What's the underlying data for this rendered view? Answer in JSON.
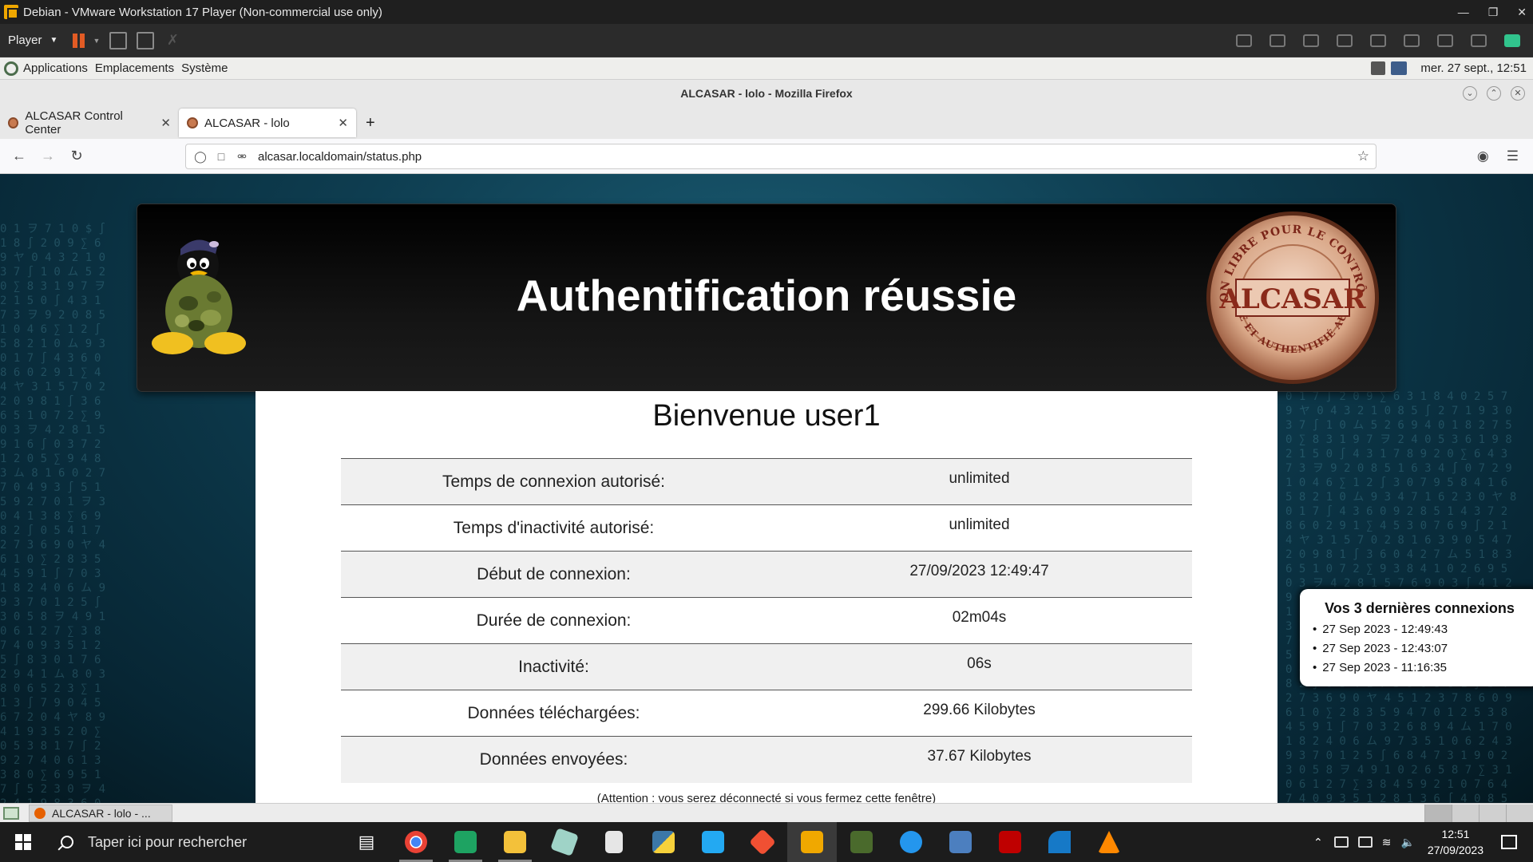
{
  "vmware": {
    "title": "Debian - VMware Workstation 17 Player (Non-commercial use only)",
    "player_menu": "Player"
  },
  "gnome_panel": {
    "menus": [
      "Applications",
      "Emplacements",
      "Système"
    ],
    "clock": "mer. 27 sept., 12:51"
  },
  "firefox": {
    "window_title": "ALCASAR - lolo - Mozilla Firefox",
    "tabs": [
      {
        "label": "ALCASAR Control Center",
        "active": false
      },
      {
        "label": "ALCASAR - lolo",
        "active": true
      }
    ],
    "url": "alcasar.localdomain/status.php"
  },
  "page": {
    "banner_title": "Authentification réussie",
    "seal_top_text": "APPLICATION LIBRE POUR LE CONTRÔLE D'ACCÈS",
    "seal_bottom_text": "SÉCURISÉ ET AUTHENTIFIÉ AU RÉSEAU",
    "seal_brand": "ALCASAR",
    "welcome": "Bienvenue user1",
    "rows": [
      {
        "label": "Temps de connexion autorisé:",
        "value": "unlimited"
      },
      {
        "label": "Temps d'inactivité autorisé:",
        "value": "unlimited"
      },
      {
        "label": "Début de connexion:",
        "value": "27/09/2023 12:49:47"
      },
      {
        "label": "Durée de connexion:",
        "value": "02m04s"
      },
      {
        "label": "Inactivité:",
        "value": "06s"
      },
      {
        "label": "Données téléchargées:",
        "value": "299.66 Kilobytes"
      },
      {
        "label": "Données envoyées:",
        "value": "37.67 Kilobytes"
      }
    ],
    "notice": "(Attention : vous serez déconnecté si vous fermez cette fenêtre)"
  },
  "last_connections": {
    "title": "Vos 3 dernières connexions",
    "items": [
      "27 Sep 2023 - 12:49:43",
      "27 Sep 2023 - 12:43:07",
      "27 Sep 2023 - 11:16:35"
    ]
  },
  "gnome_bottom": {
    "task_label": "ALCASAR - lolo - ..."
  },
  "taskbar": {
    "search_placeholder": "Taper ici pour rechercher",
    "time": "12:51",
    "date": "27/09/2023",
    "apps": [
      {
        "name": "task-view-icon"
      },
      {
        "name": "chrome-icon",
        "color": "#e94235"
      },
      {
        "name": "google-chat-icon",
        "color": "#1ea362"
      },
      {
        "name": "file-explorer-icon",
        "color": "#f3c13a"
      },
      {
        "name": "notepadpp-icon",
        "color": "#9fd3c7"
      },
      {
        "name": "document-icon",
        "color": "#e6e6e6"
      },
      {
        "name": "python-icon",
        "color": "#3b77a8"
      },
      {
        "name": "vscode-icon",
        "color": "#23a9f2"
      },
      {
        "name": "git-icon",
        "color": "#f05033"
      },
      {
        "name": "vmware-icon",
        "color": "#f0a800"
      },
      {
        "name": "pgadmin-icon",
        "color": "#4a6a2c"
      },
      {
        "name": "docker-icon",
        "color": "#2496ed"
      },
      {
        "name": "network-icon",
        "color": "#4c7fbf"
      },
      {
        "name": "filezilla-icon",
        "color": "#bf0000"
      },
      {
        "name": "wireshark-icon",
        "color": "#1679c7"
      },
      {
        "name": "vlc-icon",
        "color": "#ff8800"
      }
    ]
  }
}
